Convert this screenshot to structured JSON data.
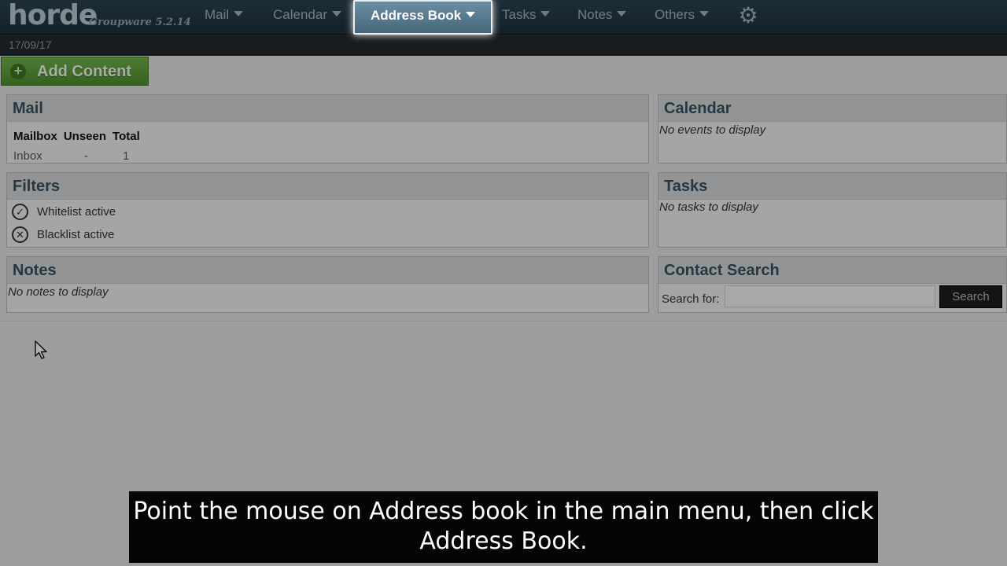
{
  "header": {
    "logo": "horde",
    "product": "Groupware 5.2.14",
    "menu": [
      {
        "label": "Mail"
      },
      {
        "label": "Calendar"
      },
      {
        "label": "Address Book",
        "active": true
      },
      {
        "label": "Tasks"
      },
      {
        "label": "Notes"
      },
      {
        "label": "Others"
      }
    ],
    "settings_icon": "gear-icon"
  },
  "datebar": {
    "date": "17/09/17"
  },
  "toolbar": {
    "add_content_label": "Add Content",
    "add_icon": "plus-circle-icon"
  },
  "portlets": {
    "mail": {
      "title": "Mail",
      "columns": [
        "Mailbox",
        "Unseen",
        "Total"
      ],
      "rows": [
        [
          "Inbox",
          "-",
          "1"
        ]
      ]
    },
    "filters": {
      "title": "Filters",
      "items": [
        {
          "name": "Whitelist",
          "status": "active",
          "icon": "check-circle-icon"
        },
        {
          "name": "Blacklist",
          "status": "active",
          "icon": "x-circle-icon"
        }
      ]
    },
    "notes": {
      "title": "Notes",
      "empty_message": "No notes to display"
    },
    "calendar": {
      "title": "Calendar",
      "empty_message": "No events to display"
    },
    "tasks": {
      "title": "Tasks",
      "empty_message": "No tasks to display"
    },
    "contact_search": {
      "title": "Contact Search",
      "search_label": "Search for:",
      "search_value": "",
      "search_button": "Search"
    }
  },
  "caption": {
    "line1": "Point the mouse on Address book in the main menu, then click",
    "line2": "Address Book."
  },
  "colors": {
    "topbar": "#1c2f3c",
    "active_menu": "#45677c",
    "add_button": "#5c9e38",
    "portlet_title": "#37505f"
  }
}
